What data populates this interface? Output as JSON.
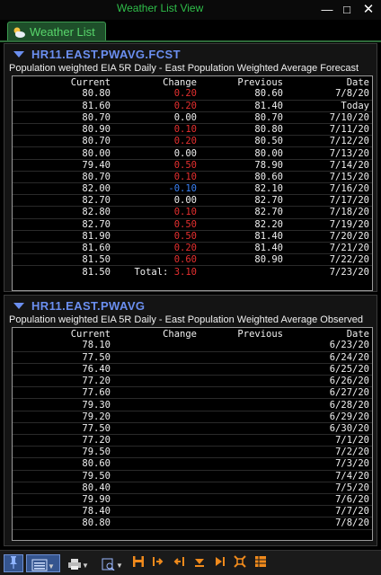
{
  "window": {
    "title": "Weather List View"
  },
  "tab": {
    "label": "Weather List"
  },
  "columns": {
    "current": "Current",
    "change": "Change",
    "previous": "Previous",
    "date": "Date"
  },
  "panel1": {
    "symbol": "HR11.EAST.PWAVG.FCST",
    "description": "Population weighted EIA 5R Daily - East Population Weighted Average Forecast",
    "rows": [
      {
        "current": "80.80",
        "change": "0.20",
        "change_sign": "pos",
        "previous": "80.60",
        "date": "7/8/20"
      },
      {
        "current": "81.60",
        "change": "0.20",
        "change_sign": "pos",
        "previous": "81.40",
        "date": "Today"
      },
      {
        "current": "80.70",
        "change": "0.00",
        "change_sign": "zero",
        "previous": "80.70",
        "date": "7/10/20"
      },
      {
        "current": "80.90",
        "change": "0.10",
        "change_sign": "pos",
        "previous": "80.80",
        "date": "7/11/20"
      },
      {
        "current": "80.70",
        "change": "0.20",
        "change_sign": "pos",
        "previous": "80.50",
        "date": "7/12/20"
      },
      {
        "current": "80.00",
        "change": "0.00",
        "change_sign": "zero",
        "previous": "80.00",
        "date": "7/13/20"
      },
      {
        "current": "79.40",
        "change": "0.50",
        "change_sign": "pos",
        "previous": "78.90",
        "date": "7/14/20"
      },
      {
        "current": "80.70",
        "change": "0.10",
        "change_sign": "pos",
        "previous": "80.60",
        "date": "7/15/20"
      },
      {
        "current": "82.00",
        "change": "-0.10",
        "change_sign": "neg",
        "previous": "82.10",
        "date": "7/16/20"
      },
      {
        "current": "82.70",
        "change": "0.00",
        "change_sign": "zero",
        "previous": "82.70",
        "date": "7/17/20"
      },
      {
        "current": "82.80",
        "change": "0.10",
        "change_sign": "pos",
        "previous": "82.70",
        "date": "7/18/20"
      },
      {
        "current": "82.70",
        "change": "0.50",
        "change_sign": "pos",
        "previous": "82.20",
        "date": "7/19/20"
      },
      {
        "current": "81.90",
        "change": "0.50",
        "change_sign": "pos",
        "previous": "81.40",
        "date": "7/20/20"
      },
      {
        "current": "81.60",
        "change": "0.20",
        "change_sign": "pos",
        "previous": "81.40",
        "date": "7/21/20"
      },
      {
        "current": "81.50",
        "change": "0.60",
        "change_sign": "pos",
        "previous": "80.90",
        "date": "7/22/20"
      }
    ],
    "last_row": {
      "current": "81.50",
      "total_label": "Total:",
      "total_value": "3.10",
      "date": "7/23/20"
    }
  },
  "panel2": {
    "symbol": "HR11.EAST.PWAVG",
    "description": "Population weighted EIA 5R Daily - East Population Weighted Average Observed",
    "rows": [
      {
        "current": "78.10",
        "date": "6/23/20"
      },
      {
        "current": "77.50",
        "date": "6/24/20"
      },
      {
        "current": "76.40",
        "date": "6/25/20"
      },
      {
        "current": "77.20",
        "date": "6/26/20"
      },
      {
        "current": "77.60",
        "date": "6/27/20"
      },
      {
        "current": "79.30",
        "date": "6/28/20"
      },
      {
        "current": "79.20",
        "date": "6/29/20"
      },
      {
        "current": "77.50",
        "date": "6/30/20"
      },
      {
        "current": "77.20",
        "date": "7/1/20"
      },
      {
        "current": "79.50",
        "date": "7/2/20"
      },
      {
        "current": "80.60",
        "date": "7/3/20"
      },
      {
        "current": "79.50",
        "date": "7/4/20"
      },
      {
        "current": "80.40",
        "date": "7/5/20"
      },
      {
        "current": "79.90",
        "date": "7/6/20"
      },
      {
        "current": "78.40",
        "date": "7/7/20"
      },
      {
        "current": "80.80",
        "date": "7/8/20"
      }
    ]
  },
  "colors": {
    "positive": "#e63030",
    "negative": "#3b82f6",
    "symbol": "#6b8ff0",
    "title": "#2fbf4a"
  },
  "toolbar": {
    "icons": [
      "pin-icon",
      "list-view-icon",
      "print-icon",
      "print-preview-icon",
      "save-icon",
      "export-icon",
      "import-icon",
      "download-icon",
      "skip-end-icon",
      "fit-icon",
      "sheet-icon"
    ]
  }
}
